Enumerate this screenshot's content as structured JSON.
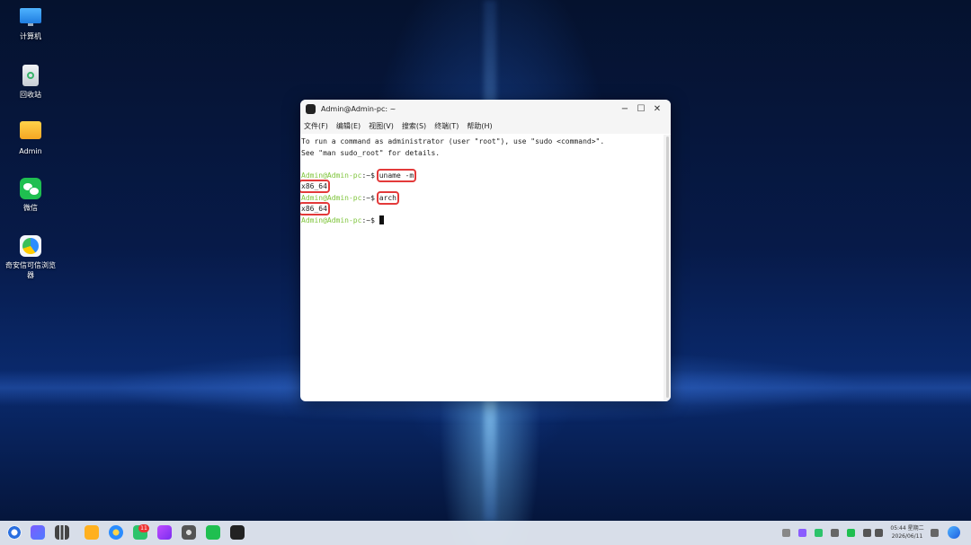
{
  "desktop": {
    "icons": [
      {
        "label": "计算机"
      },
      {
        "label": "回收站"
      },
      {
        "label": "Admin"
      },
      {
        "label": "微信"
      },
      {
        "label": "奇安信可信浏览器"
      }
    ]
  },
  "window": {
    "title": "Admin@Admin-pc: ~",
    "controls": [
      "−",
      "☐",
      "✕"
    ],
    "menu": [
      "文件(F)",
      "编辑(E)",
      "视图(V)",
      "搜索(S)",
      "终端(T)",
      "帮助(H)"
    ]
  },
  "terminal": {
    "intro_1": "To run a command as administrator (user \"root\"), use \"sudo <command>\".",
    "intro_2": "See \"man sudo_root\" for details.",
    "prompt": "Admin@Admin-pc",
    "prompt_suffix": ":~$",
    "cmd_1": "uname -m",
    "out_1": "x86_64",
    "cmd_2": "arch",
    "out_2": "x86_64"
  },
  "taskbar": {
    "badge_count": "11",
    "time": "05:44 星期二",
    "date": "2026/06/11"
  },
  "colors": {
    "prompt_green": "#7ec43a",
    "highlight_red": "#e33a3a",
    "desktop_blue": "#0a2a6e"
  }
}
